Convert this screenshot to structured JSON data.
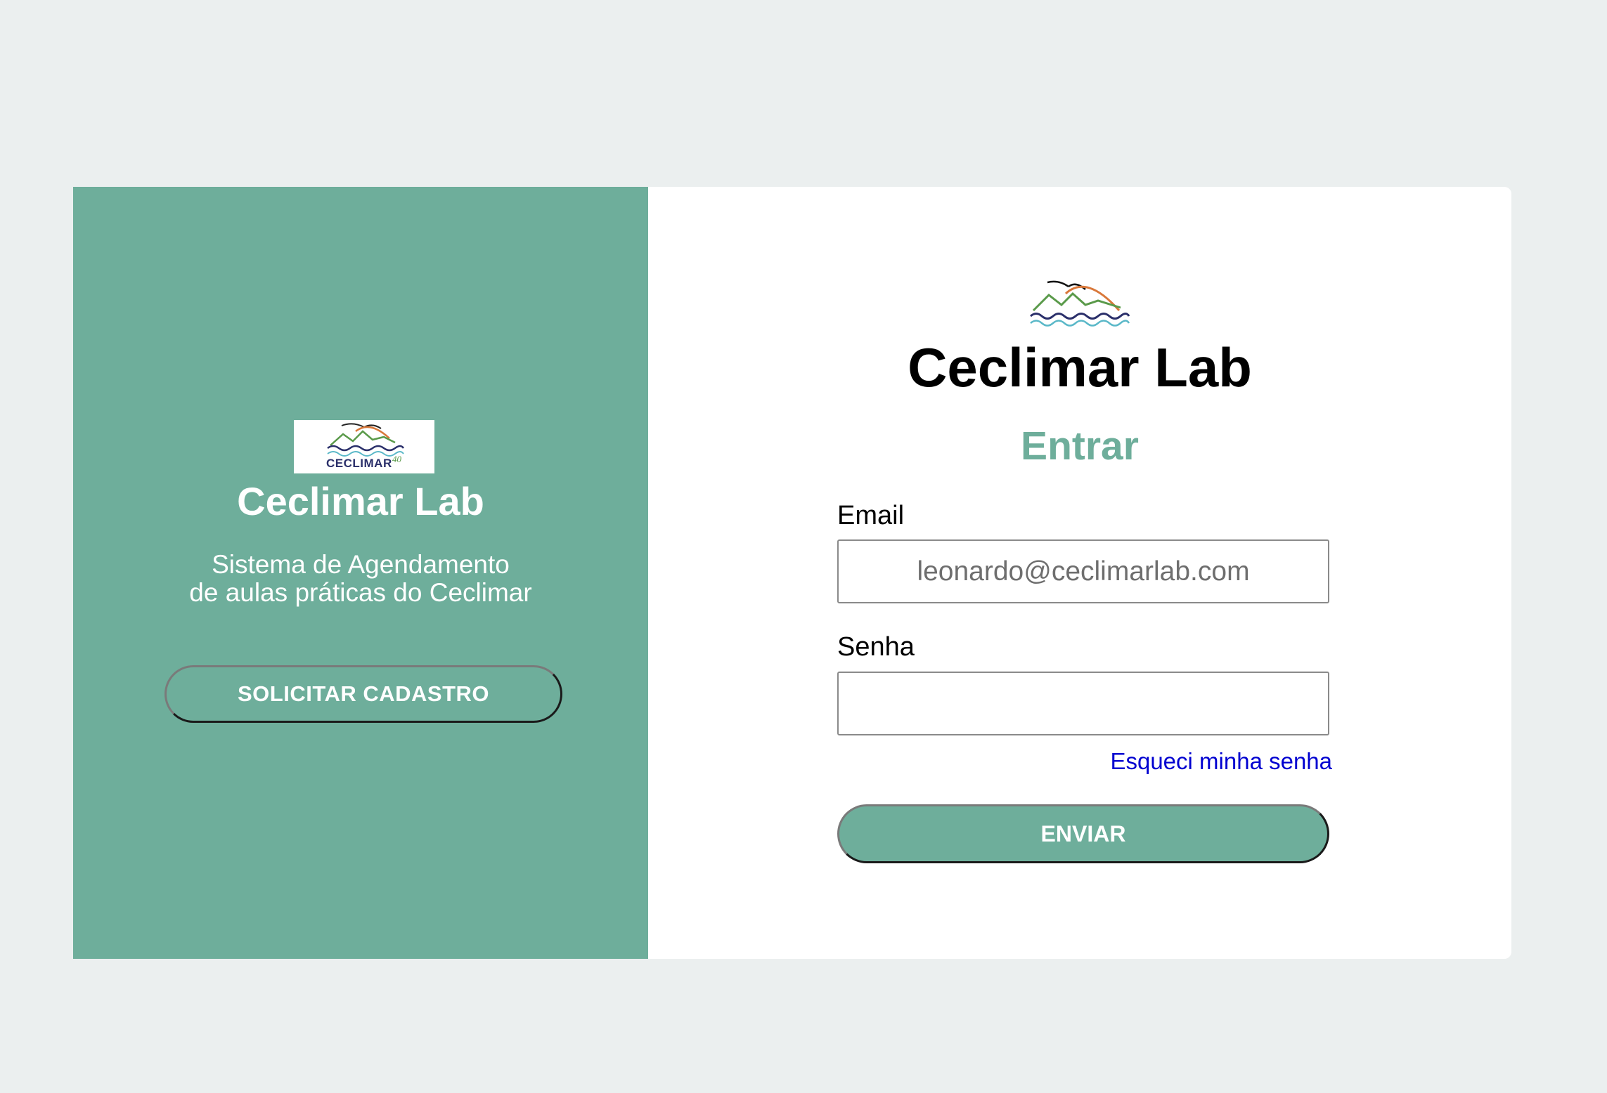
{
  "left_panel": {
    "logo_text": "CECLIMAR",
    "logo_badge": "40",
    "title": "Ceclimar Lab",
    "subtitle_line1": "Sistema de Agendamento",
    "subtitle_line2": "de aulas práticas do Ceclimar",
    "register_button": "SOLICITAR CADASTRO"
  },
  "login_form": {
    "title": "Ceclimar Lab",
    "heading": "Entrar",
    "email_label": "Email",
    "email_value": "leonardo@ceclimarlab.com",
    "password_label": "Senha",
    "password_value": "",
    "forgot_password": "Esqueci minha senha",
    "submit_button": "ENVIAR"
  },
  "colors": {
    "page_background": "#ebefef",
    "accent": "#6eae9b",
    "link": "#0000d0"
  },
  "icons": {
    "left_logo": "ceclimar-logo-icon",
    "right_logo": "ceclimar-waves-logo-icon"
  }
}
